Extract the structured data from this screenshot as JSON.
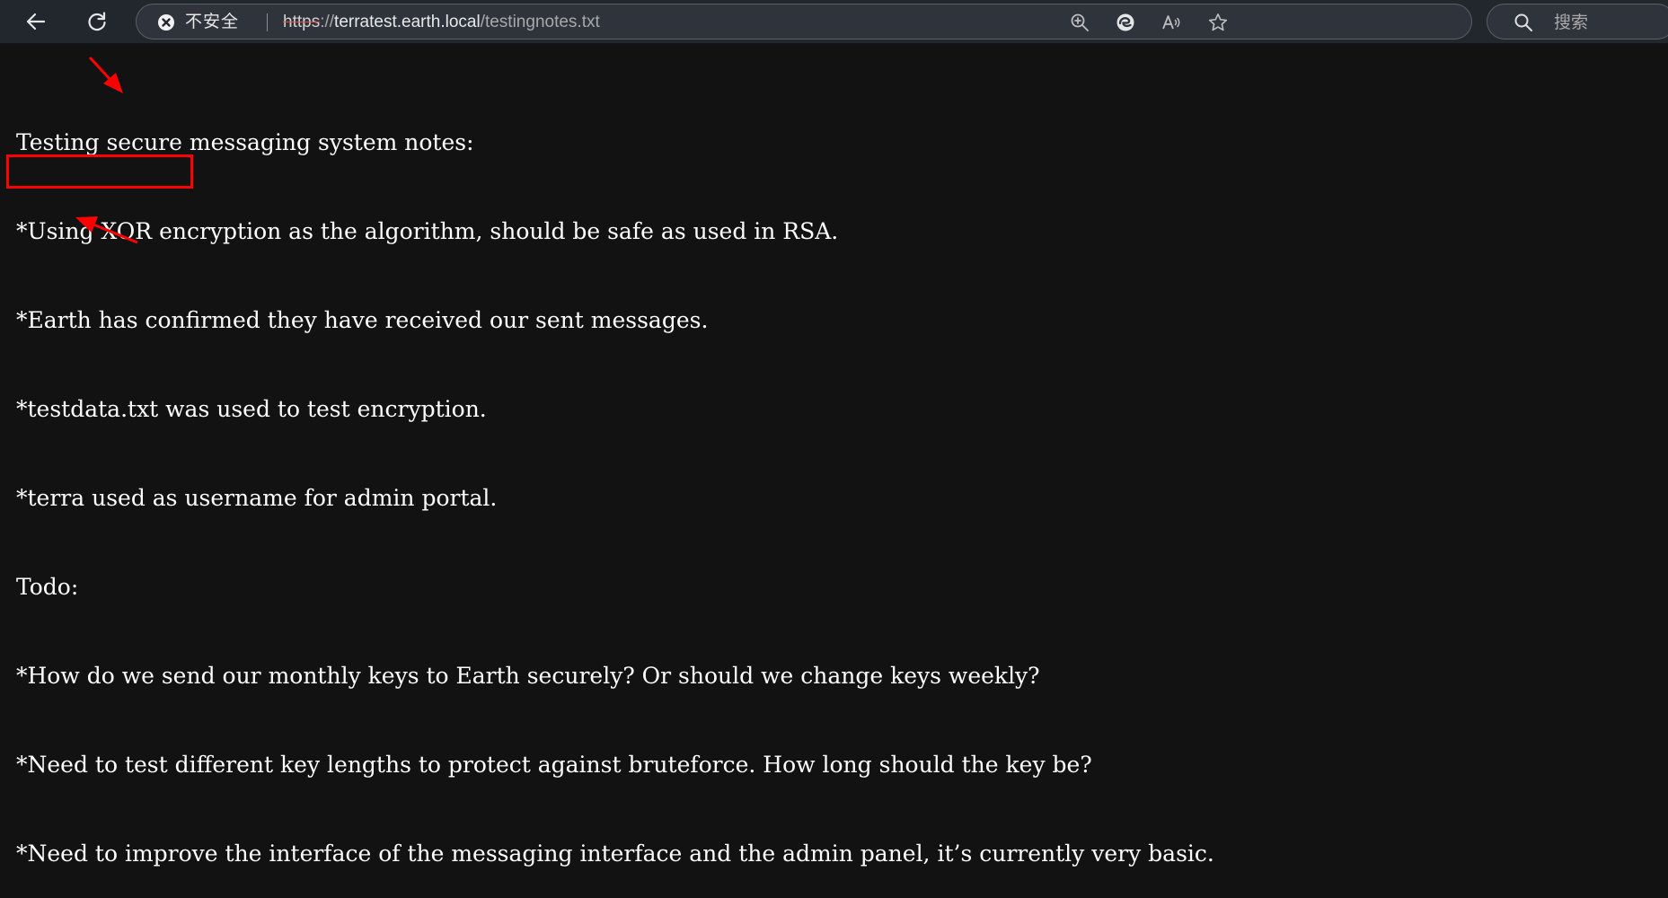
{
  "browser": {
    "security_label": "不安全",
    "url": {
      "scheme": "https",
      "separator": "://",
      "host": "terratest.earth.local",
      "path": "/testingnotes.txt"
    },
    "search": {
      "placeholder": "搜索"
    }
  },
  "document": {
    "lines": [
      "Testing secure messaging system notes:",
      "*Using XOR encryption as the algorithm, should be safe as used in RSA.",
      "*Earth has confirmed they have received our sent messages.",
      "*testdata.txt was used to test encryption.",
      "*terra used as username for admin portal.",
      "Todo:",
      "*How do we send our monthly keys to Earth securely? Or should we change keys weekly?",
      "*Need to test different key lengths to protect against bruteforce. How long should the key be?",
      "*Need to improve the interface of the messaging interface and the admin panel, it’s currently very basic."
    ]
  },
  "annotations": {
    "color": "#ff0000",
    "box_label": "testdata.txt",
    "arrow_targets": [
      "secure",
      "terra"
    ]
  },
  "colors": {
    "page_background": "#121212",
    "toolbar_background": "#22262d",
    "text": "#ffffff"
  }
}
